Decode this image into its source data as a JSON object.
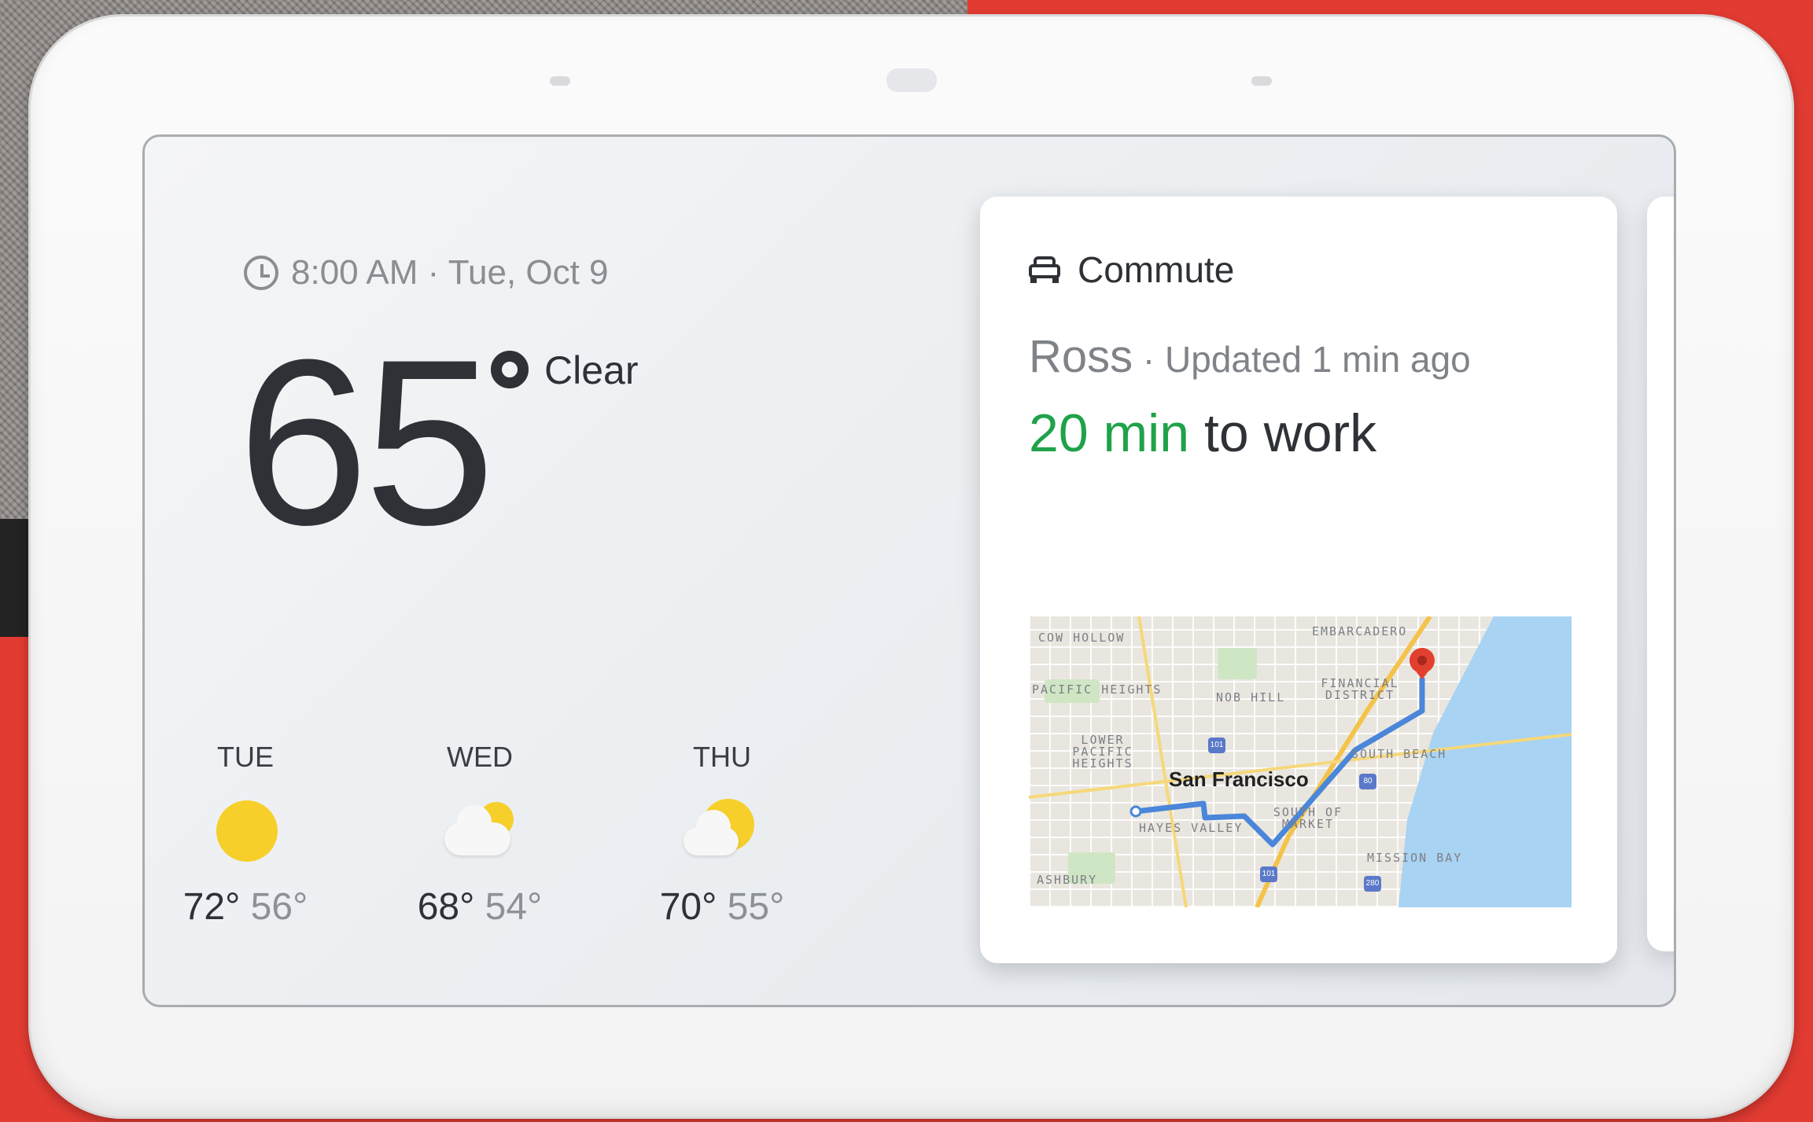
{
  "alarm": {
    "icon": "alarm-clock-icon",
    "text": "8:00 AM · Tue, Oct 9"
  },
  "weather": {
    "temperature": "65",
    "condition": "Clear",
    "icon": "degree-ring-icon"
  },
  "forecast": [
    {
      "day": "TUE",
      "icon": "sunny-icon",
      "high": "72°",
      "low": "56°"
    },
    {
      "day": "WED",
      "icon": "partly-cloudy-icon",
      "high": "68°",
      "low": "54°"
    },
    {
      "day": "THU",
      "icon": "mostly-sunny-icon",
      "high": "70°",
      "low": "55°"
    }
  ],
  "commute": {
    "icon": "car-icon",
    "title": "Commute",
    "person": "Ross",
    "updated": " · Updated 1 min ago",
    "eta_time": "20 min",
    "eta_rest": " to work"
  },
  "map": {
    "city": "San Francisco",
    "labels": [
      "COW HOLLOW",
      "EMBARCADERO",
      "PACIFIC HEIGHTS",
      "NOB HILL",
      "FINANCIAL DISTRICT",
      "LOWER PACIFIC HEIGHTS",
      "SOUTH BEACH",
      "HAYES VALLEY",
      "SOUTH OF MARKET",
      "MISSION BAY",
      "ASHBURY"
    ],
    "shields": [
      "101",
      "80",
      "101",
      "280"
    ]
  },
  "colors": {
    "eta_green": "#1fa24a",
    "route_blue": "#4a86d9",
    "pin_red": "#e2402f",
    "sun_yellow": "#f7cf2a"
  }
}
